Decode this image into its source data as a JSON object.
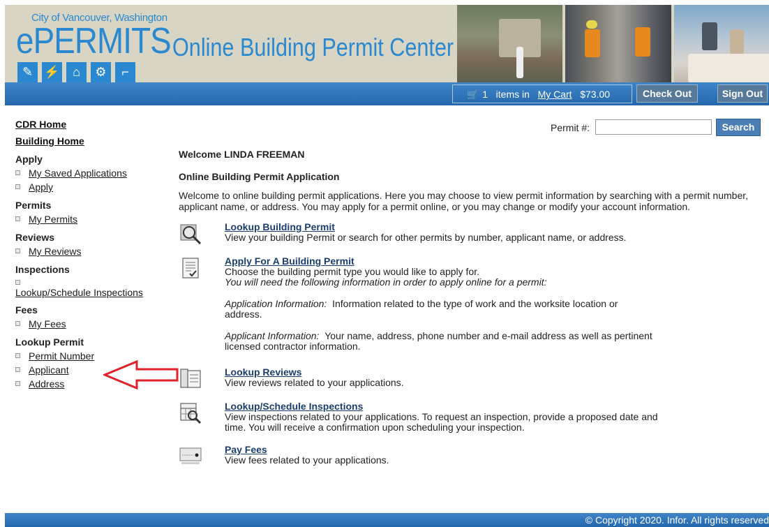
{
  "header": {
    "city_name": "City of Vancouver, Washington",
    "logo_text": "ePERMITS",
    "site_title": "Online Building Permit Center"
  },
  "cart": {
    "count": "1",
    "items_in": "items in",
    "link_label": "My Cart",
    "total": "$73.00",
    "checkout_label": "Check Out",
    "signout_label": "Sign Out"
  },
  "sidebar": {
    "cdr_home": "CDR Home",
    "building_home": "Building Home",
    "sections": [
      {
        "heading": "Apply",
        "items": [
          "My Saved Applications",
          "Apply"
        ]
      },
      {
        "heading": "Permits",
        "items": [
          "My Permits"
        ]
      },
      {
        "heading": "Reviews",
        "items": [
          "My Reviews"
        ]
      },
      {
        "heading": "Inspections",
        "items": [
          "Lookup/Schedule Inspections"
        ]
      },
      {
        "heading": "Fees",
        "items": [
          "My Fees"
        ]
      },
      {
        "heading": "Lookup Permit",
        "items": [
          "Permit Number",
          "Applicant",
          "Address"
        ]
      }
    ]
  },
  "search": {
    "label": "Permit #:",
    "value": "",
    "button": "Search"
  },
  "main": {
    "welcome": "Welcome LINDA FREEMAN",
    "subhead": "Online Building Permit Application",
    "intro": "Welcome to online building permit applications. Here you may choose to view permit information by searching with a permit number, applicant name, or address. You may apply for a permit online, or you may change or modify your account information.",
    "lookup_permit": {
      "title": "Lookup Building Permit",
      "desc": "View your building Permit or search for other permits by number, applicant name, or address."
    },
    "apply_permit": {
      "title": "Apply For A Building Permit",
      "desc": "Choose the building permit type you would like to apply for.",
      "note": "You will need the following information in order to apply online for a permit:",
      "app_info_label": "Application Information:",
      "app_info_text": "Information related to the type of work and the worksite location or address.",
      "applicant_info_label": "Applicant Information:",
      "applicant_info_text": "Your name, address, phone number and e-mail address as well as pertinent licensed contractor information."
    },
    "lookup_reviews": {
      "title": "Lookup Reviews",
      "desc": "View reviews related to your applications."
    },
    "lookup_inspections": {
      "title": "Lookup/Schedule Inspections",
      "desc": "View inspections related to your applications. To request an inspection, provide a proposed date and time. You will receive a confirmation upon scheduling your inspection."
    },
    "pay_fees": {
      "title": "Pay Fees",
      "desc": "View fees related to your applications."
    }
  },
  "footer": {
    "copyright": "© Copyright 2020. Infor. All rights reserved"
  },
  "colors": {
    "brand_blue": "#2a88d0",
    "nav_blue": "#2467ad",
    "header_beige": "#d8d5c4",
    "annotation_red": "#e0202a"
  }
}
